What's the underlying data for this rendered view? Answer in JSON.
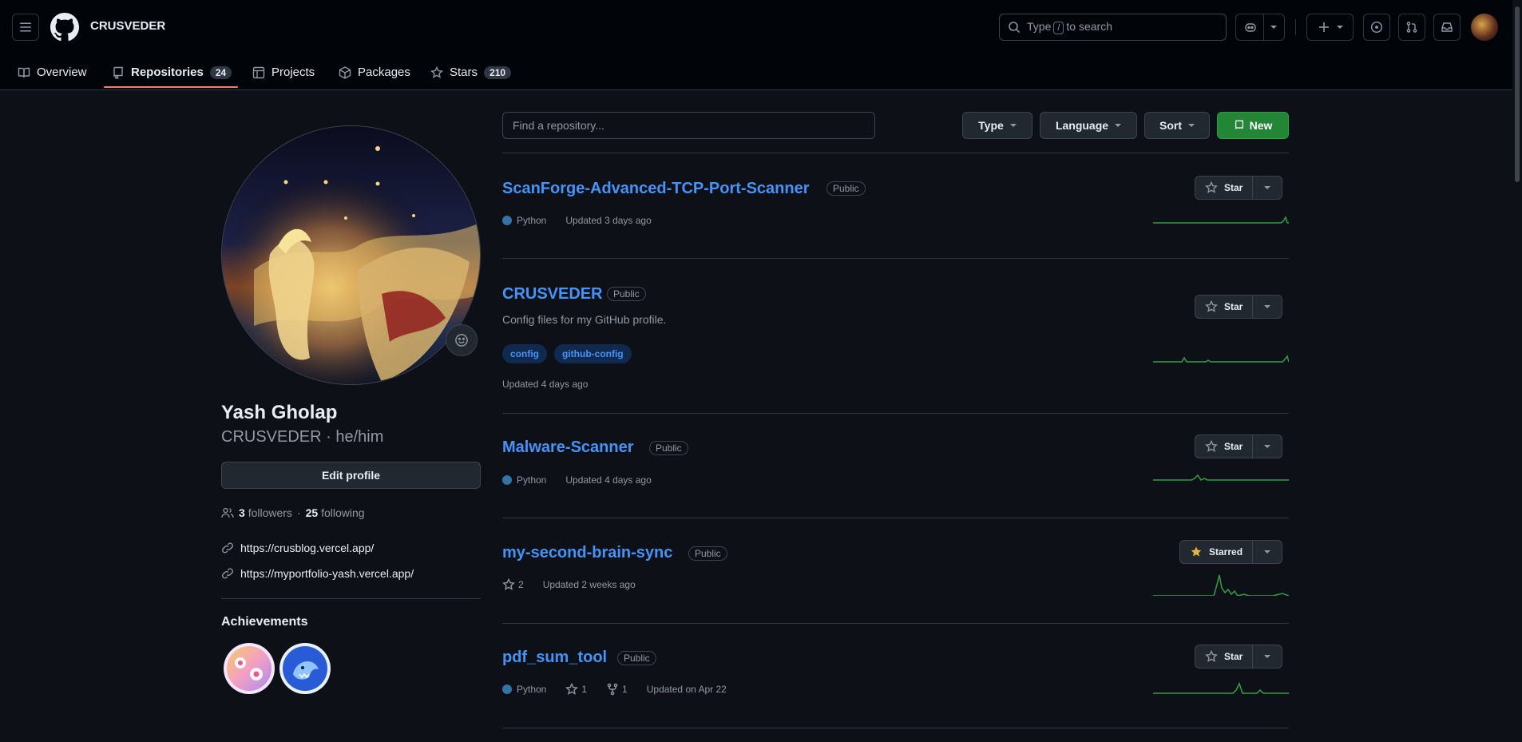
{
  "header": {
    "owner": "CRUSVEDER",
    "search_prefix": "Type",
    "search_key": "/",
    "search_suffix": "to search"
  },
  "tabs": [
    {
      "label": "Overview",
      "count": null
    },
    {
      "label": "Repositories",
      "count": "24"
    },
    {
      "label": "Projects",
      "count": null
    },
    {
      "label": "Packages",
      "count": null
    },
    {
      "label": "Stars",
      "count": "210"
    }
  ],
  "profile": {
    "name": "Yash Gholap",
    "login_pronouns": "CRUSVEDER · he/him",
    "edit_label": "Edit profile",
    "followers_count": "3",
    "followers_label": "followers",
    "following_count": "25",
    "following_label": "following",
    "links": [
      "https://crusblog.vercel.app/",
      "https://myportfolio-yash.vercel.app/"
    ],
    "achievements_title": "Achievements"
  },
  "filters": {
    "placeholder": "Find a repository...",
    "type_label": "Type",
    "language_label": "Language",
    "sort_label": "Sort",
    "new_label": "New"
  },
  "repos": [
    {
      "name": "ScanForge-Advanced-TCP-Port-Scanner",
      "visibility": "Public",
      "language": "Python",
      "updated": "Updated 3 days ago",
      "star_label": "Star"
    },
    {
      "name": "CRUSVEDER",
      "visibility": "Public",
      "description": "Config files for my GitHub profile.",
      "topics": [
        "config",
        "github-config"
      ],
      "updated": "Updated 4 days ago",
      "star_label": "Star"
    },
    {
      "name": "Malware-Scanner",
      "visibility": "Public",
      "language": "Python",
      "updated": "Updated 4 days ago",
      "star_label": "Star"
    },
    {
      "name": "my-second-brain-sync",
      "visibility": "Public",
      "stars": "2",
      "updated": "Updated 2 weeks ago",
      "star_label": "Starred"
    },
    {
      "name": "pdf_sum_tool",
      "visibility": "Public",
      "language": "Python",
      "stars": "1",
      "forks": "1",
      "updated": "Updated on Apr 22",
      "star_label": "Star"
    }
  ],
  "colors": {
    "accent": "#4493f8",
    "python": "#3572A5",
    "new_button": "#238636",
    "tab_underline": "#f78166",
    "sparkline": "#2ea043",
    "starred_icon": "#e3b341"
  },
  "icons": {
    "menu": "hamburger-icon",
    "logo": "github-mark-icon",
    "search": "search-icon",
    "copilot": "copilot-icon",
    "create": "plus-icon",
    "issues": "issue-opened-icon",
    "pulls": "git-pull-request-icon",
    "inbox": "inbox-icon",
    "overview": "book-icon",
    "repositories": "repo-icon",
    "projects": "table-icon",
    "packages": "package-icon",
    "stars": "star-icon",
    "followers": "people-icon",
    "link": "link-icon",
    "new_repo": "repo-icon",
    "fork": "repo-forked-icon",
    "smiley": "smiley-icon"
  }
}
